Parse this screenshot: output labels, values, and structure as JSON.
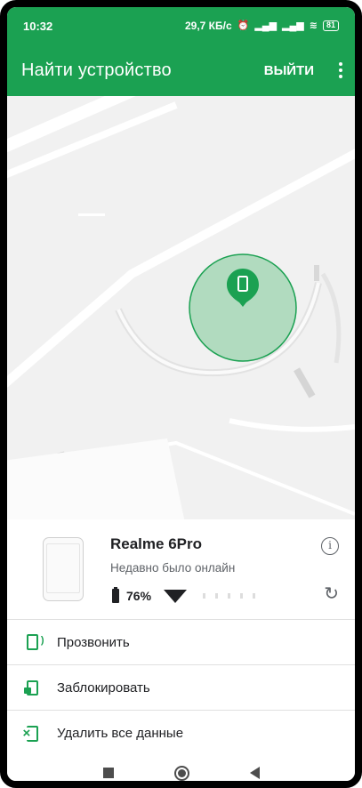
{
  "status_bar": {
    "time": "10:32",
    "net_speed": "29,7 КБ/с",
    "battery": "81"
  },
  "app_bar": {
    "title": "Найти устройство",
    "logout_label": "ВЫЙТИ"
  },
  "device": {
    "name": "Realme 6Pro",
    "status": "Недавно было онлайн",
    "battery_percent": "76%"
  },
  "actions": [
    {
      "label": "Прозвонить",
      "icon": "ring-device-icon"
    },
    {
      "label": "Заблокировать",
      "icon": "lock-device-icon"
    },
    {
      "label": "Удалить все данные",
      "icon": "erase-device-icon"
    }
  ],
  "colors": {
    "brand_green": "#1ba152",
    "accuracy_circle": "#8fd0a4"
  }
}
